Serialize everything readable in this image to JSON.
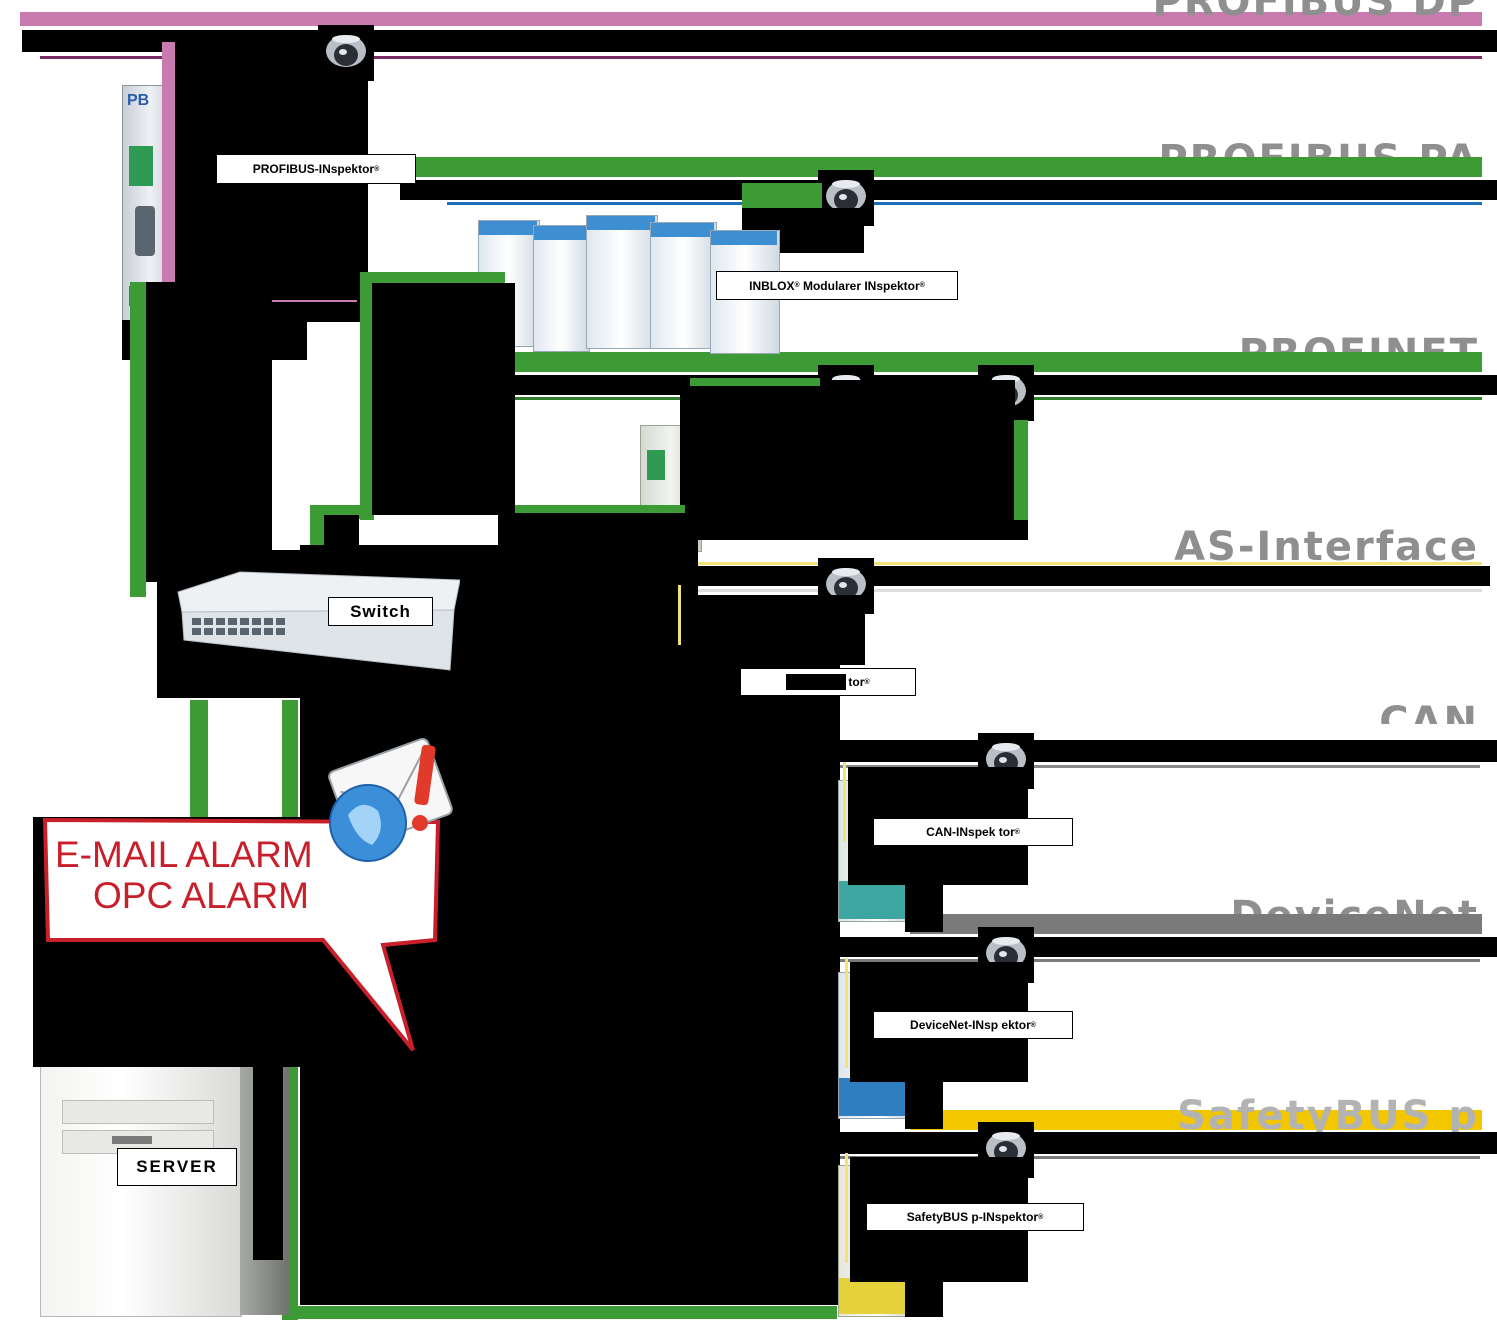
{
  "buses": {
    "profibus_dp": "PROFIBUS DP",
    "profibus_pa": "PROFIBUS PA",
    "profinet": "PROFINET",
    "as_interface": "AS-Interface",
    "can": "CAN",
    "devicenet": "DeviceNet",
    "safetybus": "SafetyBUS p"
  },
  "labels": {
    "profibus_inspektor": "PROFIBUS-INspektor",
    "inblox_a": "INBLOX",
    "inblox_b": "Modularer INspektor",
    "asi_inspektor": "tor",
    "can_inspektor": "CAN-INspek tor",
    "devicenet_inspektor": "DeviceNet-INsp ektor",
    "safetybus_inspektor": "SafetyBUS p-INspektor",
    "switch": "Switch",
    "server": "SERVER",
    "registered": "®"
  },
  "alarm": {
    "line1": "E-MAIL ALARM",
    "line2": "OPC ALARM"
  },
  "colors": {
    "profibus_dp": "#c97bb0",
    "profibus_pa": "#3d9b35",
    "profinet": "#3d9b35",
    "as_interface": "#f3e27a",
    "can": "#888888",
    "devicenet": "#7a7a7a",
    "safetybus": "#f2c700",
    "ethernet": "#3d9b35",
    "alarm_text": "#c8202a",
    "bus_title": "#8f8f8f"
  },
  "icons": {
    "camera": "dome-camera-icon",
    "alarm": "email-alarm-icon"
  }
}
